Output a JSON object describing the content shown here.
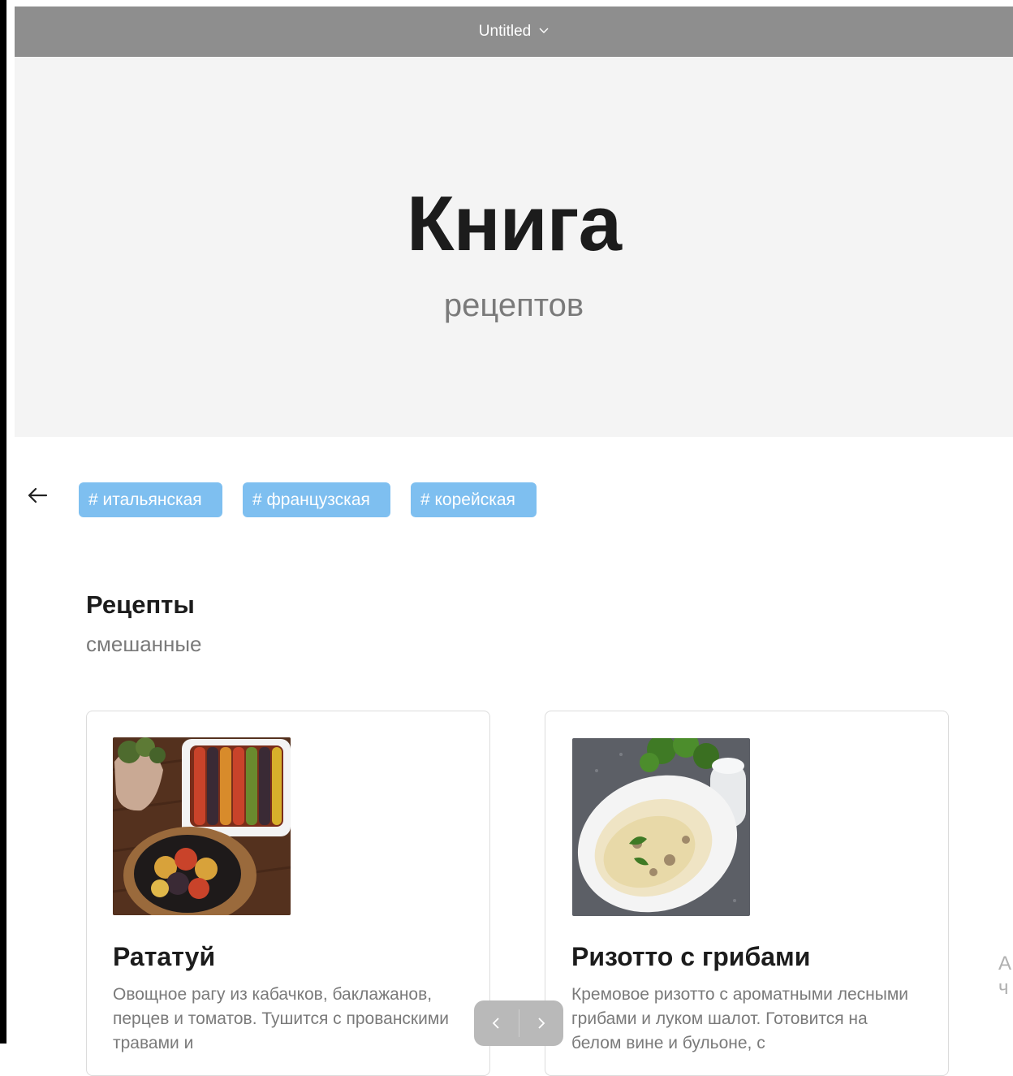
{
  "window": {
    "title": "Untitled"
  },
  "hero": {
    "title": "Книга",
    "subtitle": "рецептов"
  },
  "tags": [
    "# итальянская",
    "# французская",
    "# корейская"
  ],
  "section": {
    "title": "Рецепты",
    "subtitle": "смешанные"
  },
  "recipes": [
    {
      "title": "Рататуй",
      "description": "Овощное рагу из кабачков, баклажанов, перцев и томатов. Тушится с прованскими травами и"
    },
    {
      "title": "Ризотто с грибами",
      "description": "Кремовое ризотто с ароматными лесными грибами и луком шалот. Готовится на белом вине и бульоне, с"
    }
  ],
  "edge_cutoff_text": [
    "А",
    "ч"
  ],
  "colors": {
    "accent": "#7ebff0",
    "titlebar": "#8e8e8e",
    "hero_bg": "#f4f4f4"
  }
}
